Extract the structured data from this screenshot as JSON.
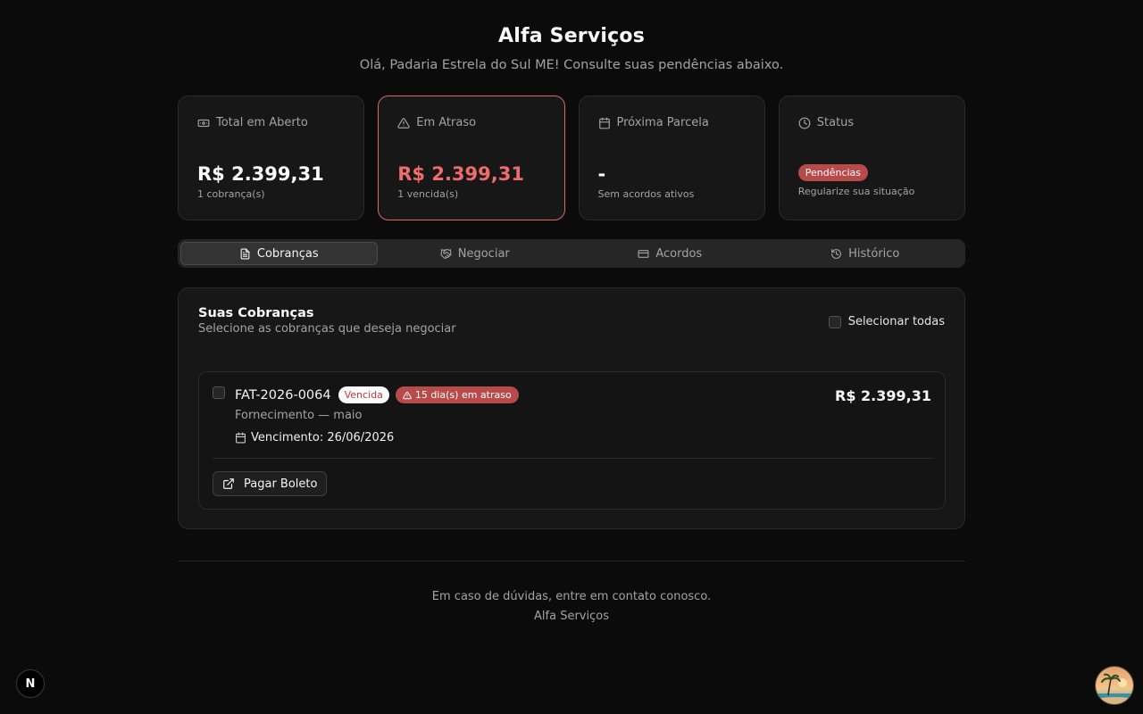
{
  "header": {
    "title": "Alfa Serviços",
    "subtitle": "Olá, Padaria Estrela do Sul ME! Consulte suas pendências abaixo."
  },
  "cards": {
    "total": {
      "label": "Total em Aberto",
      "value": "R$ 2.399,31",
      "sub": "1 cobrança(s)",
      "icon": "money-icon"
    },
    "overdue": {
      "label": "Em Atraso",
      "value": "R$ 2.399,31",
      "sub": "1 vencida(s)",
      "icon": "alert-triangle-icon"
    },
    "next": {
      "label": "Próxima Parcela",
      "value": "-",
      "sub": "Sem acordos ativos",
      "icon": "calendar-icon"
    },
    "status": {
      "label": "Status",
      "badge": "Pendências",
      "sub": "Regularize sua situação",
      "icon": "clock-icon"
    }
  },
  "tabs": [
    {
      "label": "Cobranças",
      "icon": "file-icon",
      "active": true
    },
    {
      "label": "Negociar",
      "icon": "handshake-icon",
      "active": false
    },
    {
      "label": "Acordos",
      "icon": "card-icon",
      "active": false
    },
    {
      "label": "Histórico",
      "icon": "history-icon",
      "active": false
    }
  ],
  "panel": {
    "title": "Suas Cobranças",
    "subtitle": "Selecione as cobranças que deseja negociar",
    "select_all": "Selecionar todas",
    "items": [
      {
        "code": "FAT-2026-0064",
        "status_badge": "Vencida",
        "late_badge": "15 dia(s) em atraso",
        "description": "Fornecimento — maio",
        "due": "Vencimento: 26/06/2026",
        "amount": "R$ 2.399,31",
        "action": "Pagar Boleto"
      }
    ]
  },
  "footer": {
    "line1": "Em caso de dúvidas, entre em contato conosco.",
    "line2": "Alfa Serviços"
  },
  "dev_badge": "N",
  "colors": {
    "background": "#0b0b0b",
    "card": "#171717",
    "danger": "#f06b6b",
    "badge_red": "#b84a4a"
  }
}
